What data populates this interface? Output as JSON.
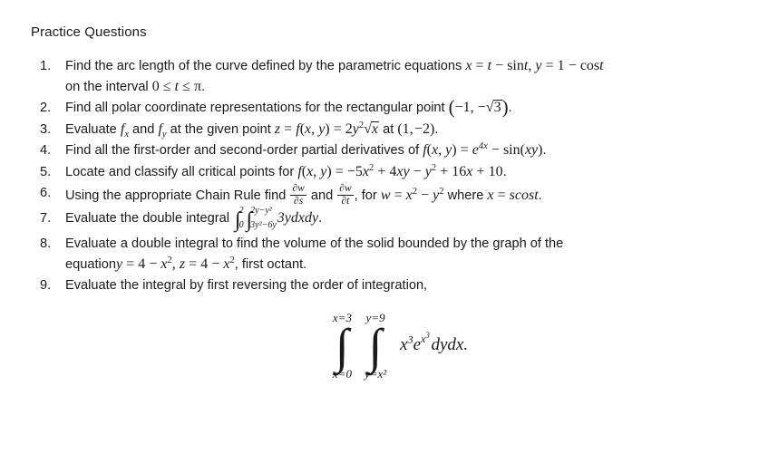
{
  "document": {
    "title": "Practice Questions",
    "background_color": "#ffffff",
    "text_color": "#1a1a1a"
  },
  "questions": [
    {
      "number": "1.",
      "line1_lead": "Find the arc length of the curve defined by the parametric equations ",
      "math1": "x = t − sint, y = 1 − cost",
      "line2_lead": "on the interval ",
      "math2": "0 ≤ t ≤ π",
      "line2_tail": "."
    },
    {
      "number": "2.",
      "lead": "Find all polar coordinate representations for the rectangular point ",
      "math": "(−1, −√3)",
      "tail": "."
    },
    {
      "number": "3.",
      "lead": "Evaluate ",
      "math_fx": "f",
      "math_fx_sub": "x",
      "mid": " and ",
      "math_fy": "f",
      "math_fy_sub": "y",
      "mid2": " at the given point ",
      "math": "z = f(x, y) = 2y²√x",
      "tail_lead": " at ",
      "point": "(1, −2)",
      "tail": "."
    },
    {
      "number": "4.",
      "lead": "Find all the first-order and second-order partial derivatives of ",
      "math": "f(x, y) = e⁴ˣ − sin(xy)",
      "tail": "."
    },
    {
      "number": "5.",
      "lead": "Locate and classify all critical points for ",
      "math": "f(x, y) = −5x² + 4xy − y² + 16x + 10",
      "tail": "."
    },
    {
      "number": "6.",
      "lead": "Using the appropriate Chain Rule find ",
      "frac1_num": "∂w",
      "frac1_den": "∂s",
      "mid": " and ",
      "frac2_num": "∂w",
      "frac2_den": "∂t",
      "mid2": ", for ",
      "math": "w = x² − y²",
      "mid3": " where ",
      "math2": "x = scost",
      "tail": "."
    },
    {
      "number": "7.",
      "lead": "Evaluate the double integral ",
      "int1_upper": "2",
      "int1_lower": "0",
      "int2_upper": "2y−y²",
      "int2_lower": "3y²−6y",
      "integrand": "3ydxdy",
      "tail": "."
    },
    {
      "number": "8.",
      "line1": "Evaluate a double integral to find the volume of the solid bounded by the graph of the",
      "line2_lead": "equation",
      "line2_math": "y = 4 − x², z = 4 − x²",
      "line2_tail": ", first octant."
    },
    {
      "number": "9.",
      "text": "Evaluate the integral by first reversing the order of integration,"
    }
  ],
  "display_integral": {
    "outer_upper": "x=3",
    "outer_lower": "x=0",
    "outer_glyph": "∫",
    "inner_upper": "y=9",
    "inner_lower": "y=x²",
    "inner_glyph": "∫",
    "integrand_base": "x",
    "integrand_exp": "3",
    "integrand_e": "e",
    "integrand_e_exp_base": "x",
    "integrand_e_exp_exp": "3",
    "differentials": "dydx",
    "period": "."
  }
}
